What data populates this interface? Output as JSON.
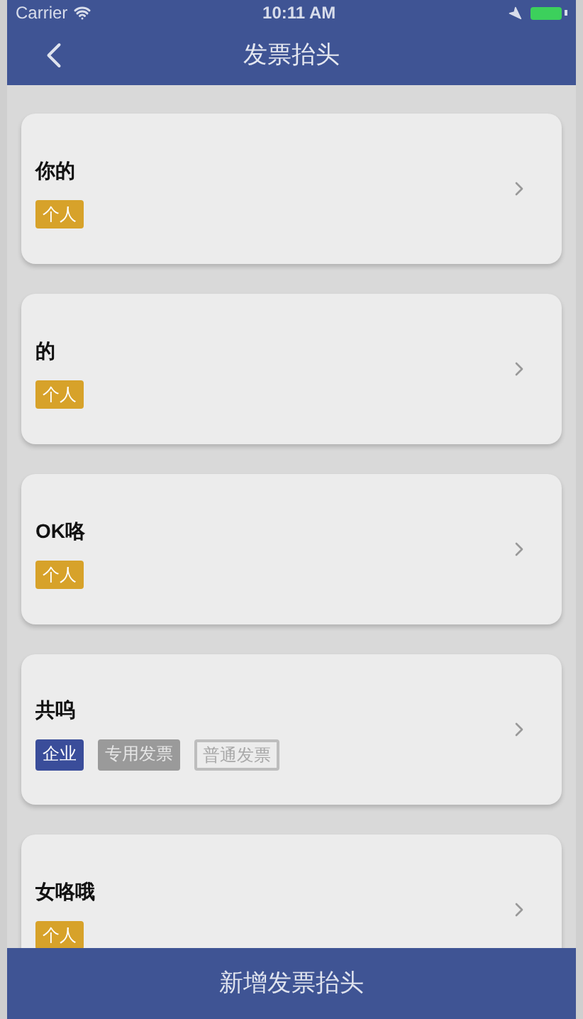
{
  "status_bar": {
    "carrier": "Carrier",
    "time": "10:11 AM"
  },
  "nav": {
    "title": "发票抬头"
  },
  "invoices": [
    {
      "name": "你的",
      "tags": [
        {
          "kind": "personal",
          "label": "个人"
        }
      ]
    },
    {
      "name": "的",
      "tags": [
        {
          "kind": "personal",
          "label": "个人"
        }
      ]
    },
    {
      "name": "OK咯",
      "tags": [
        {
          "kind": "personal",
          "label": "个人"
        }
      ]
    },
    {
      "name": "共呜",
      "tags": [
        {
          "kind": "company",
          "label": "企业"
        },
        {
          "kind": "special",
          "label": "专用发票"
        },
        {
          "kind": "normal",
          "label": "普通发票"
        }
      ]
    },
    {
      "name": "女咯哦",
      "tags": [
        {
          "kind": "personal",
          "label": "个人"
        }
      ]
    }
  ],
  "add_button": {
    "label": "新增发票抬头"
  }
}
